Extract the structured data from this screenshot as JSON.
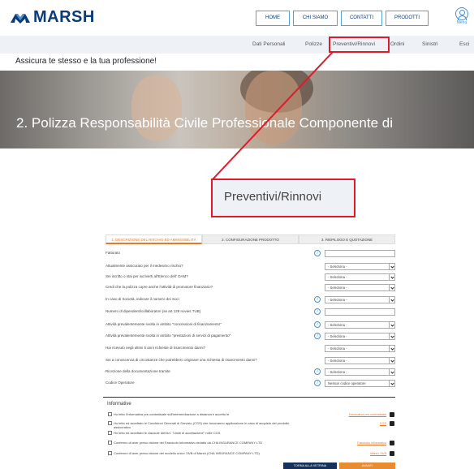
{
  "header": {
    "logo_text": "MARSH",
    "nav": [
      {
        "label": "HOME",
        "width": 42
      },
      {
        "label": "CHI SIAMO",
        "width": 55
      },
      {
        "label": "CONTATTI",
        "width": 51
      },
      {
        "label": "PRODOTTI",
        "width": 53
      }
    ],
    "menu_label": "Menu"
  },
  "subnav": [
    "Dati Personali",
    "Polizze",
    "Preventivi/Rinnovi",
    "Ordini",
    "Sinistri",
    "Esci"
  ],
  "tagline": "Assicura te stesso e la tua professione!",
  "hero_title": "2. Polizza Responsabilità Civile Professionale Componente di",
  "callout": "Preventivi/Rinnovi",
  "steps": [
    "1. DESCRIZIONE DEL RISCHIO ED AMMISSIBILITÀ",
    "2. CONFIGURAZIONE PRODOTTO",
    "3. RIEPILOGO E QUOTAZIONE"
  ],
  "questions": [
    {
      "text": "Fatturato",
      "info": true,
      "field": "text",
      "value": ""
    },
    {
      "text": "Attualmente assicurato per il medesimo rischio?",
      "info": false,
      "field": "select",
      "value": "- Seleziona -"
    },
    {
      "text": "Sei iscritto o stai per iscriverti all'Elenco dell' OAM?",
      "info": false,
      "field": "select",
      "value": "- Seleziona -"
    },
    {
      "text": "Credi che la polizza copre anche l'attività di promotore finanziario?",
      "info": false,
      "field": "select",
      "value": "- Seleziona -"
    },
    {
      "text": "In caso di Società, indicare il numero dei Soci",
      "info": true,
      "field": "select",
      "value": "- Seleziona -"
    },
    {
      "text": "Numero di dipendenti/collaboratori (se art 128 novies TUB)",
      "info": true,
      "field": "text",
      "value": ""
    },
    {
      "text": "Attività prevalentemente svolta in ambito \"concessioni di finanziamento\"",
      "info": true,
      "field": "select",
      "value": "- Seleziona -"
    },
    {
      "text": "Attività prevalentemente svolta in ambito \"prestazioni di servizi di pagamento\"",
      "info": true,
      "field": "select",
      "value": "- Seleziona -"
    },
    {
      "text": "Hai ricevuto negli ultimi 5 anni richieste di risarcimento danni?",
      "info": false,
      "field": "select",
      "value": "- Seleziona -"
    },
    {
      "text": "Sei a conoscenza di circostanze che potrebbero originare una richiesta di risarcimento danni?",
      "info": false,
      "field": "select",
      "value": "- Seleziona -"
    },
    {
      "text": "Ricezione della documentazione tramite",
      "info": true,
      "field": "select",
      "value": "- Seleziona -"
    },
    {
      "text": "Codice Operatore",
      "info": true,
      "field": "select",
      "value": "Nessun codice operatore"
    }
  ],
  "informative_title": "Informative",
  "informative": [
    {
      "text": "Ho letto l'informativa pre-contrattuale sull'intermediazione a distanza e accetto le",
      "link": "Informativa pre-contrattuale",
      "pdf": true
    },
    {
      "text": "Ho letto ed accettato le Condizioni Generali di Servizio (CGS) che troveranno applicazione in caso di acquisto del prodotto assicurativo",
      "link": "CGS",
      "pdf": true
    },
    {
      "text": "Ho letto ed accettato le clausole dell'Art. \"Limiti di accettazione\" nelle CGS",
      "link": "",
      "pdf": false
    },
    {
      "text": "Confermo di aver preso visione del Fascicolo Informativo redatto da CHA INSURANCE COMPANY LTD",
      "link": "Fascicolo Informativo",
      "pdf": true
    },
    {
      "text": "Confermo di aver preso visione del modello unico 7A/B di Marsh (CNA INSURANCE COMPANY LTD)",
      "link": "Marsh 7A/B",
      "pdf": true
    }
  ],
  "buttons": {
    "back": "TORNA ALLA VETRINA",
    "next": "AVANTI"
  },
  "colors": {
    "brand": "#0a3b7a",
    "accent": "#e98b2f",
    "highlight": "#e0192b"
  }
}
